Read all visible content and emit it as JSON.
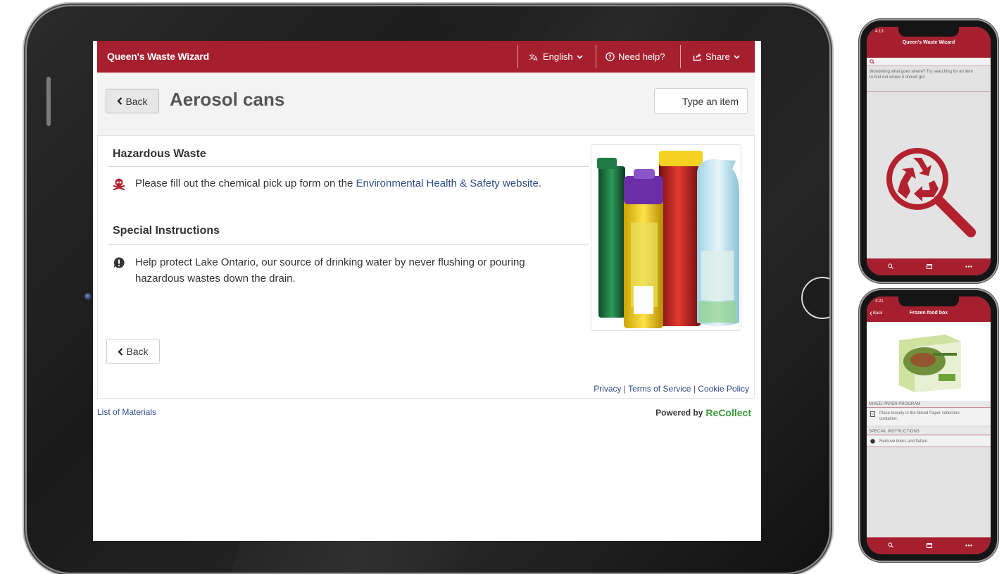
{
  "app": {
    "title": "Queen's Waste Wizard",
    "brand_color": "#a51f2e",
    "link_color": "#2e4d89"
  },
  "header": {
    "language_label": "English",
    "help_label": "Need help?",
    "share_label": "Share"
  },
  "titlebar": {
    "back_label": "Back",
    "page_title": "Aerosol cans",
    "search_placeholder": "Type an item"
  },
  "sections": {
    "hazardous": {
      "heading": "Hazardous Waste",
      "icon": "skull-crossbones-icon",
      "text_before": "Please fill out the chemical pick up form on the ",
      "link_text": "Environmental Health & Safety website",
      "text_after": "."
    },
    "special": {
      "heading": "Special Instructions",
      "icon": "exclamation-bubble-icon",
      "line1": "Help protect Lake Ontario, our source of drinking water by never flushing or pouring",
      "line2": "hazardous wastes down the drain."
    }
  },
  "bottom": {
    "back_label": "Back"
  },
  "footer": {
    "privacy": "Privacy",
    "terms": "Terms of Service",
    "cookie": "Cookie Policy",
    "list_of_materials": "List of Materials",
    "powered_by": "Powered by",
    "brand": "ReCollect"
  },
  "phone1": {
    "time": "4:13",
    "title": "Queen's Waste Wizard",
    "search_icon": "search-icon",
    "prompt": "Wondering what goes where? Try searching for an item to find out where it should go!"
  },
  "phone2": {
    "time": "4:21",
    "back_label": "Back",
    "title": "Frozen food box",
    "section1_heading": "MIXED PAPER PROGRAM",
    "section1_text": "Place loosely in the Mixed Paper collection container.",
    "section2_heading": "SPECIAL INSTRUCTIONS",
    "section2_text": "Remove liners and flatten."
  }
}
